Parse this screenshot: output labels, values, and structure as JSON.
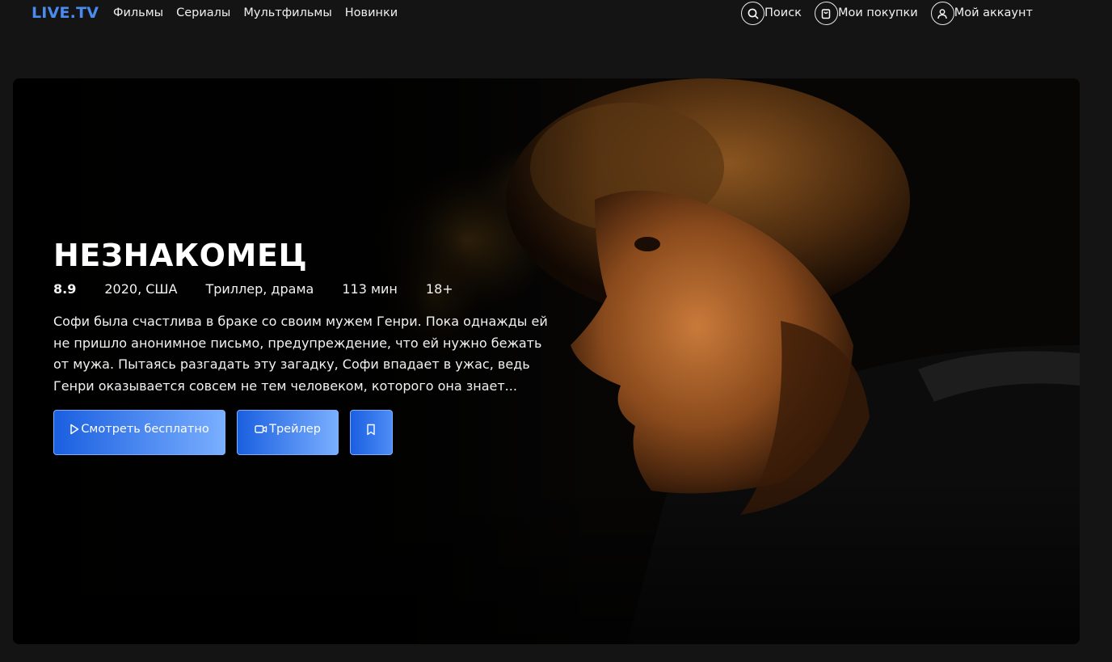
{
  "header": {
    "logo": "LIVE.TV",
    "nav": [
      {
        "label": "Фильмы"
      },
      {
        "label": "Сериалы"
      },
      {
        "label": "Мультфильмы"
      },
      {
        "label": "Новинки"
      }
    ],
    "actions": {
      "search": {
        "label": "Поиск",
        "icon": "search-icon"
      },
      "purchases": {
        "label": "Мои покупки",
        "icon": "shopping-bag-icon"
      },
      "account": {
        "label": "Мой аккаунт",
        "icon": "user-icon"
      }
    }
  },
  "hero": {
    "title": "НЕЗНАКОМЕЦ",
    "rating": "8.9",
    "year_country": "2020, США",
    "genres": "Триллер, драма",
    "duration": "113 мин",
    "age_rating": "18+",
    "description": "Софи была счастлива в браке со своим мужем Генри. Пока однажды ей не пришло анонимное письмо, предупреждение, что ей нужно бежать от мужа. Пытаясь разгадать эту загадку, Софи впадает в ужас, ведь Генри оказывается совсем не тем человеком, которого она знает...",
    "buttons": {
      "watch": {
        "label": "Смотреть бесплатно",
        "icon": "play-icon"
      },
      "trailer": {
        "label": "Трейлер",
        "icon": "video-camera-icon"
      },
      "bookmark": {
        "icon": "bookmark-icon"
      }
    }
  },
  "colors": {
    "background": "#141414",
    "logo": "#4a8bf0",
    "button_gradient_start": "#1a5fe0",
    "button_gradient_end": "#7aafff"
  }
}
